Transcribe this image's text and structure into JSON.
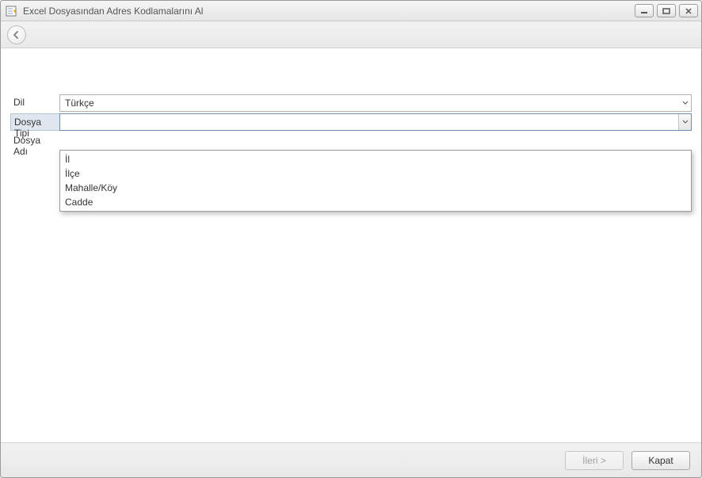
{
  "window": {
    "title": "Excel Dosyasından Adres Kodlamalarını Al"
  },
  "form": {
    "dil": {
      "label": "Dil",
      "value": "Türkçe"
    },
    "dosyaTipi": {
      "label": "Dosya Tipi",
      "value": "",
      "options": [
        "İl",
        "İlçe",
        "Mahalle/Köy",
        "Cadde"
      ]
    },
    "dosyaAdi": {
      "label": "Dosya Adı",
      "value": ""
    }
  },
  "footer": {
    "next": "İleri >",
    "close": "Kapat"
  }
}
